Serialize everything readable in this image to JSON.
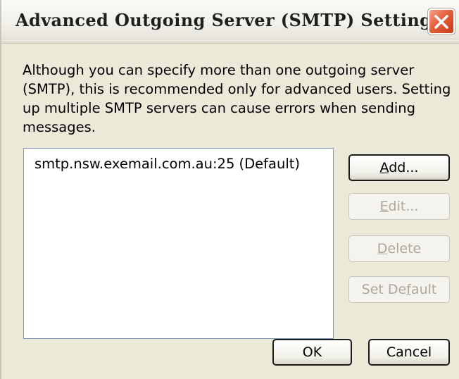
{
  "window": {
    "title": "Advanced Outgoing Server (SMTP) Settings"
  },
  "description": "Although you can specify more than one outgoing server (SMTP), this is recommended only for advanced users. Setting up multiple SMTP servers can cause errors when sending messages.",
  "server_list": {
    "items": [
      "smtp.nsw.exemail.com.au:25 (Default)"
    ]
  },
  "buttons": {
    "add": {
      "label": "Add...",
      "mnemonic": "A",
      "rest": "dd...",
      "enabled": true
    },
    "edit": {
      "label": "Edit...",
      "mnemonic": "E",
      "rest": "dit...",
      "enabled": false
    },
    "delete": {
      "label": "Delete",
      "mnemonic": "D",
      "rest": "elete",
      "enabled": false
    },
    "set_default": {
      "label": "Set Default",
      "before": "Set De",
      "mnemonic": "f",
      "rest": "ault",
      "enabled": false
    },
    "ok": {
      "label": "OK"
    },
    "cancel": {
      "label": "Cancel"
    }
  },
  "icons": {
    "close": "close-icon"
  },
  "colors": {
    "dialog_background": "#ece9d8",
    "list_border": "#7f9db9",
    "close_button": "#e5603d",
    "disabled_text": "#aca899"
  }
}
